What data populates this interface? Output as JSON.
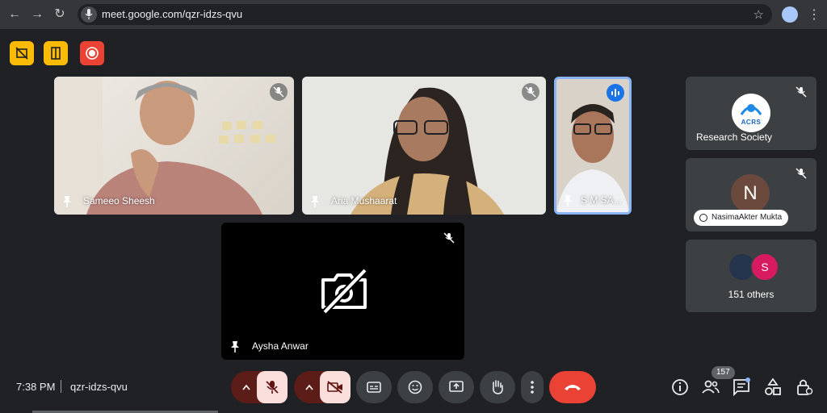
{
  "browser": {
    "url": "meet.google.com/qzr-idzs-qvu"
  },
  "participants": [
    {
      "name": "Sameeo Sheesh"
    },
    {
      "name": "Aria Mushaarat"
    },
    {
      "name": "S M SA..."
    },
    {
      "name": "Aysha Anwar"
    }
  ],
  "side_panel": {
    "research_tile_label": "Research Society",
    "research_logo_text": "ACRS",
    "nasima_initial": "N",
    "nasima_name": "NasimaAkter Mukta",
    "others_initial": "S",
    "others_label": "151 others"
  },
  "bottom_bar": {
    "time": "7:38 PM",
    "meeting_code": "qzr-idzs-qvu",
    "people_count": "157"
  },
  "colors": {
    "accent_red": "#ea4335",
    "host_yellow": "#f9bb05",
    "active_speaker_blue": "#8ab4f8",
    "mic_off_bg": "#f9dedc"
  }
}
